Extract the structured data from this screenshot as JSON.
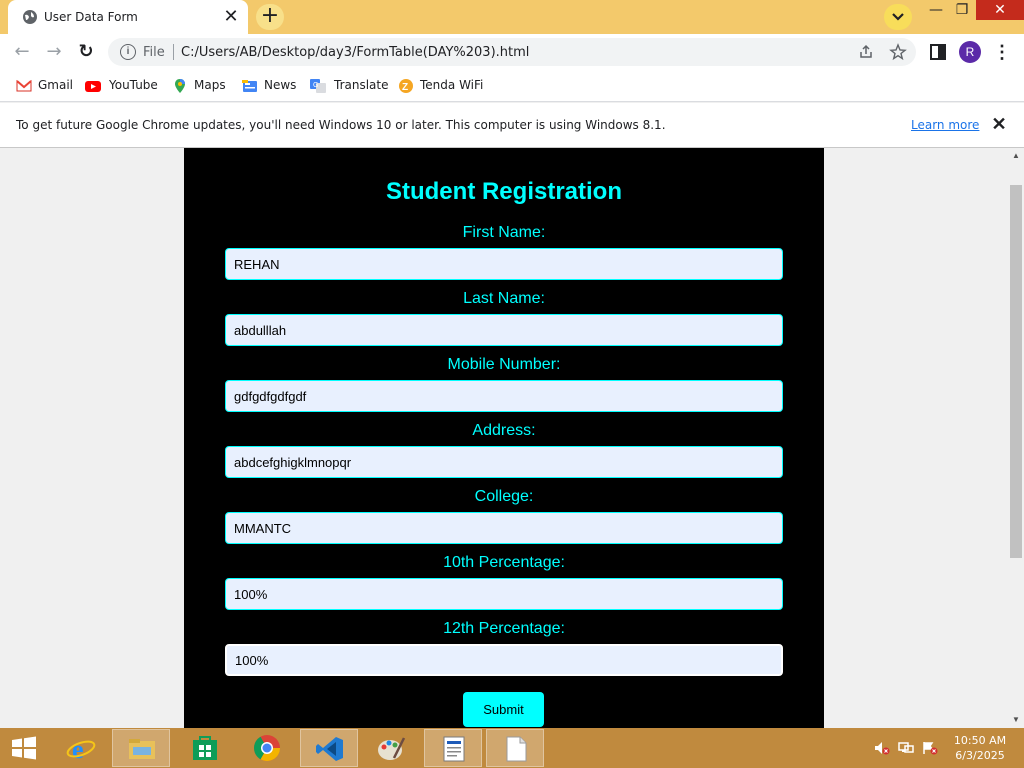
{
  "browser": {
    "tab_title": "User Data Form",
    "tab_close": "✕",
    "new_tab": "+",
    "window_controls": {
      "minimize": "—",
      "maximize": "❐",
      "close": "✕"
    },
    "nav": {
      "back": "←",
      "forward": "→",
      "reload": "↻"
    },
    "address": {
      "info": "i",
      "file_label": "File",
      "url": "C:/Users/AB/Desktop/day3/FormTable(DAY%203).html"
    },
    "profile_initial": "R",
    "menu": "⋮"
  },
  "bookmarks": [
    {
      "label": "Gmail",
      "icon": "gmail-icon"
    },
    {
      "label": "YouTube",
      "icon": "youtube-icon"
    },
    {
      "label": "Maps",
      "icon": "maps-icon"
    },
    {
      "label": "News",
      "icon": "news-icon"
    },
    {
      "label": "Translate",
      "icon": "translate-icon"
    },
    {
      "label": "Tenda WiFi",
      "icon": "tenda-icon"
    }
  ],
  "infobar": {
    "message": "To get future Google Chrome updates, you'll need Windows 10 or later. This computer is using Windows 8.1.",
    "learn_more": "Learn more",
    "close": "✕"
  },
  "form": {
    "title": "Student Registration",
    "fields": [
      {
        "label": "First Name:",
        "value": "REHAN"
      },
      {
        "label": "Last Name:",
        "value": "abdulllah"
      },
      {
        "label": "Mobile Number:",
        "value": "gdfgdfgdfgdf"
      },
      {
        "label": "Address:",
        "value": "abdcefghigklmnopqr"
      },
      {
        "label": "College:",
        "value": "MMANTC"
      },
      {
        "label": "10th Percentage:",
        "value": "100%"
      },
      {
        "label": "12th Percentage:",
        "value": "100%"
      }
    ],
    "submit_label": "Submit"
  },
  "scrollbar": {
    "up": "▲",
    "down": "▼"
  },
  "taskbar": {
    "time": "10:50 AM",
    "date": "6/3/2025"
  },
  "colors": {
    "accent": "#00ffff",
    "form_background": "#000000",
    "input_background": "#e8f0fe",
    "title_bar": "#f3c96b",
    "taskbar": "#c08a3e"
  }
}
